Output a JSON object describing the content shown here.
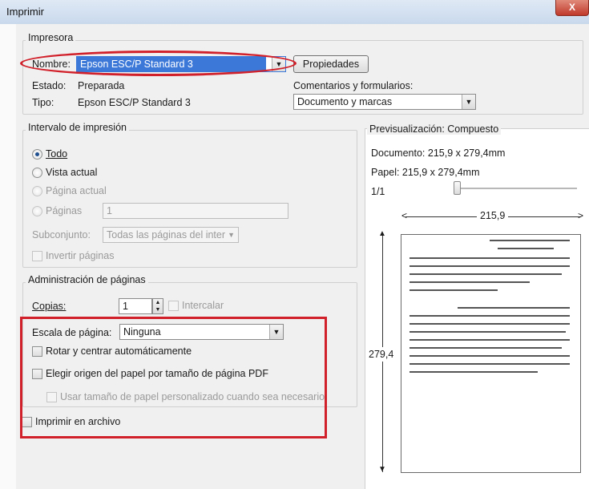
{
  "window": {
    "title": "Imprimir",
    "close_glyph": "X"
  },
  "printer": {
    "legend": "Impresora",
    "name_label": "Nombre:",
    "name_value": "Epson ESC/P Standard 3",
    "properties_button": "Propiedades",
    "status_label": "Estado:",
    "status_value": "Preparada",
    "type_label": "Tipo:",
    "type_value": "Epson ESC/P Standard 3",
    "comments_label": "Comentarios y formularios:",
    "comments_value": "Documento y marcas"
  },
  "print_range": {
    "legend": "Intervalo de impresión",
    "all": "Todo",
    "current_view": "Vista actual",
    "current_page": "Página actual",
    "pages": "Páginas",
    "pages_value": "1",
    "subset_label": "Subconjunto:",
    "subset_value": "Todas las páginas del inter",
    "reverse_pages": "Invertir páginas"
  },
  "page_handling": {
    "legend": "Administración de páginas",
    "copies_label": "Copias:",
    "copies_value": "1",
    "collate": "Intercalar",
    "scaling_label": "Escala de página:",
    "scaling_value": "Ninguna",
    "auto_rotate": "Rotar y centrar automáticamente",
    "choose_source": "Elegir origen del papel por tamaño de página PDF",
    "custom_paper": "Usar tamaño de papel personalizado cuando sea necesario"
  },
  "print_to_file": "Imprimir en archivo",
  "preview": {
    "legend": "Previsualización: Compuesto",
    "document": "Documento: 215,9 x 279,4mm",
    "paper": "Papel: 215,9 x 279,4mm",
    "page_counter": "1/1",
    "width": "215,9",
    "height": "279,4",
    "slider_position": 0.0
  },
  "colors": {
    "highlight": "#3c78d8",
    "annotation": "#d1202a",
    "dialog_bg": "#f0f0f0"
  }
}
